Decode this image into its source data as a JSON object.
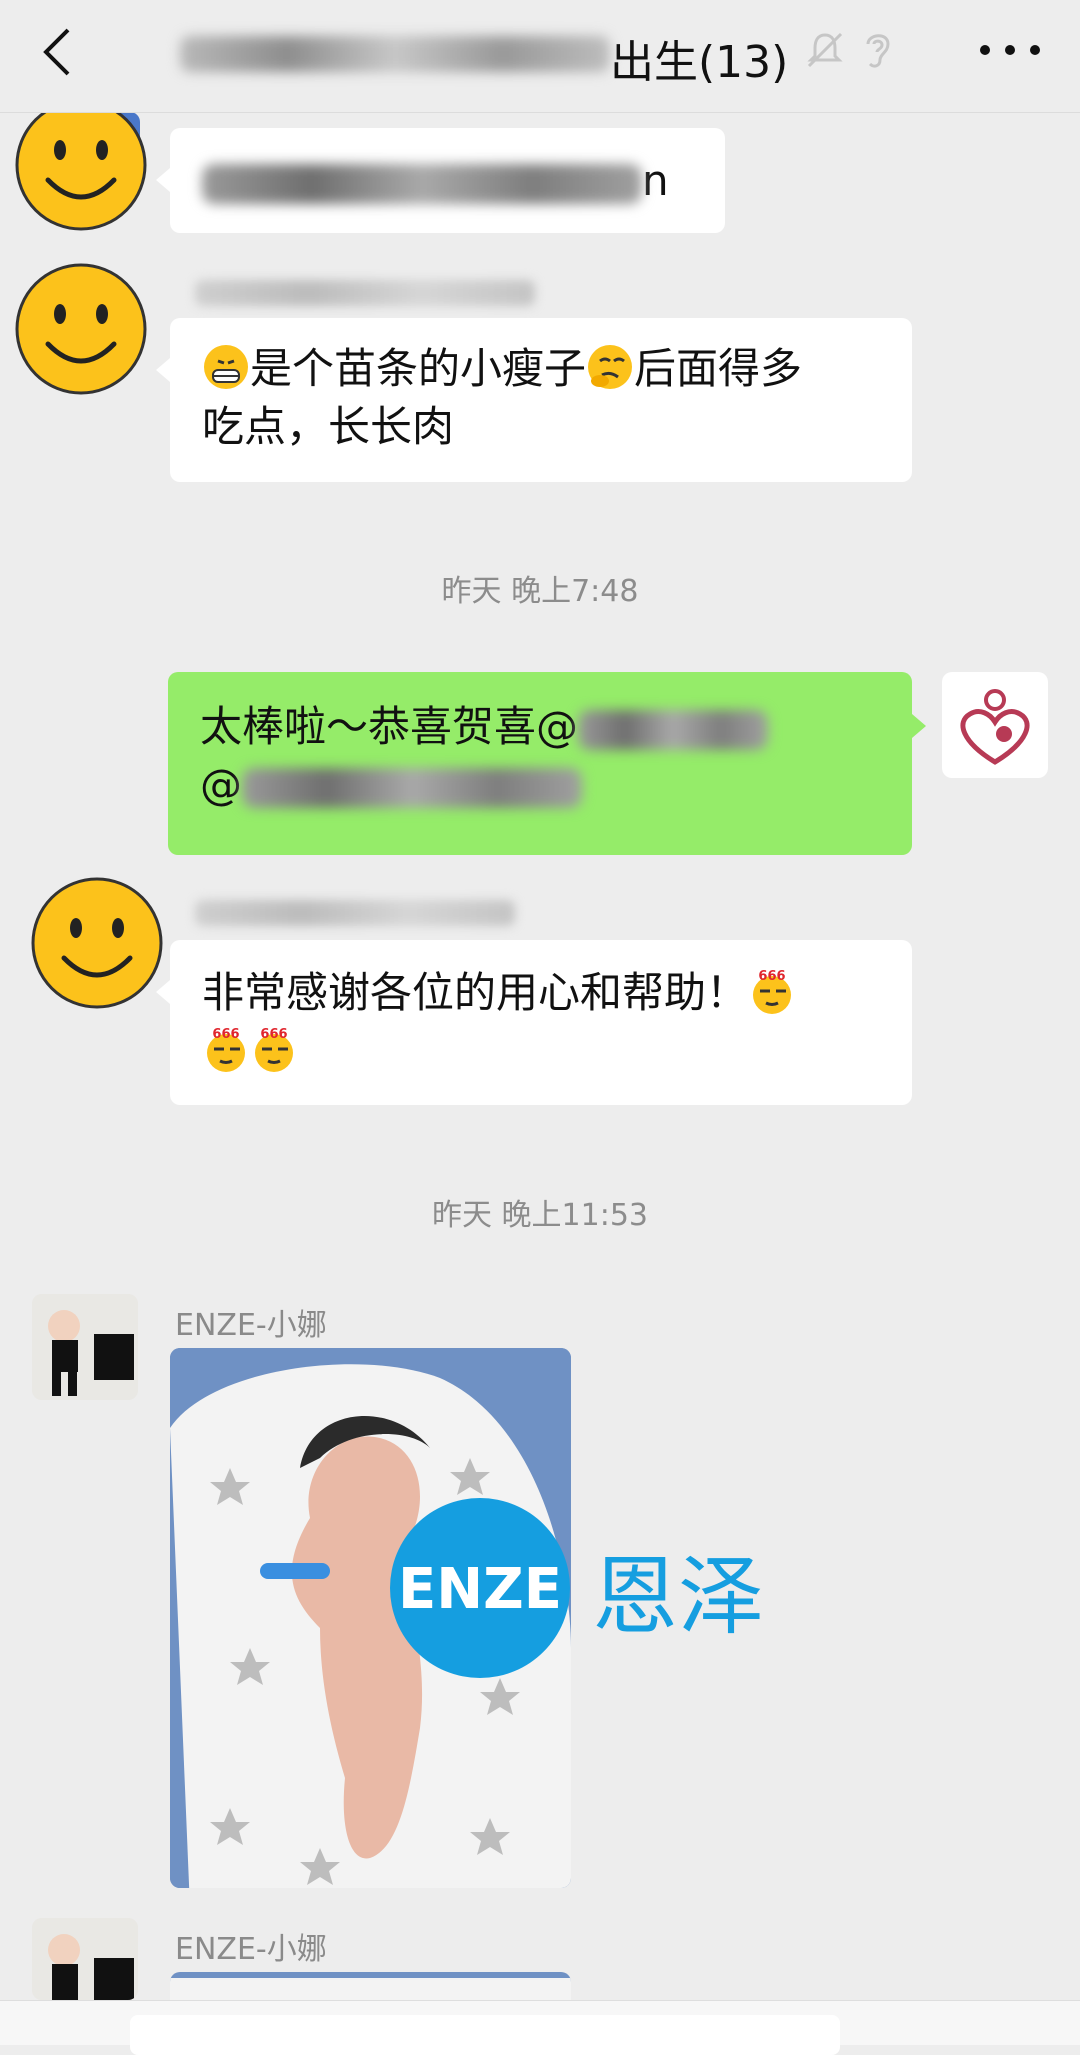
{
  "header": {
    "title_suffix": "出生(13)",
    "icons": [
      "back-icon",
      "mute-bell-icon",
      "earpiece-icon",
      "more-icon"
    ]
  },
  "messages": [
    {
      "type": "received",
      "text_visible_end": "n"
    },
    {
      "type": "received",
      "text_a": "是个苗条的小瘦子",
      "text_b": "后面得多",
      "text_c": "吃点，长长肉"
    },
    {
      "type": "time",
      "text": "昨天 晚上7:48"
    },
    {
      "type": "sent",
      "text_a": "太棒啦～恭喜贺喜@",
      "text_b": "@"
    },
    {
      "type": "received",
      "text": "非常感谢各位的用心和帮助！"
    },
    {
      "type": "time",
      "text": "昨天 晚上11:53"
    },
    {
      "type": "received-image",
      "sender": "ENZE-小娜"
    },
    {
      "type": "received-image",
      "sender": "ENZE-小娜"
    }
  ],
  "watermark": {
    "logo": "ENZE",
    "chinese": "恩泽"
  },
  "colors": {
    "sent_bubble": "#95ec69",
    "background": "#ededed",
    "watermark_blue": "#159ee0"
  }
}
